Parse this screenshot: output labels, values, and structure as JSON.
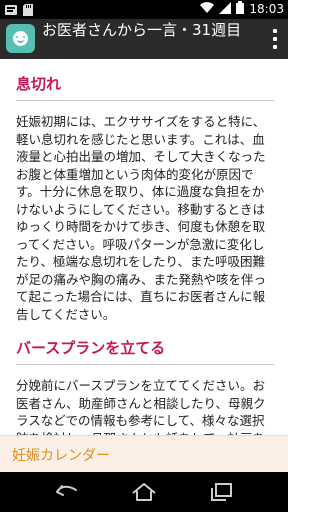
{
  "status_bar": {
    "time": "18:03",
    "icons": [
      "notification-icon",
      "sd-card-icon",
      "wifi-icon",
      "signal-icon",
      "battery-icon"
    ]
  },
  "action_bar": {
    "title": "お医者さんから一言・31週目",
    "app_icon": "smiley-face-icon",
    "overflow_icon": "overflow-menu-icon"
  },
  "content": {
    "sections": [
      {
        "title": "息切れ",
        "body": "妊娠初期には、エクササイズをすると特に、軽い息切れを感じたと思います。これは、血液量と心拍出量の増加、そして大きくなったお腹と体重増加という肉体的変化が原因です。十分に休息を取り、体に過度な負担をかけないようにしてください。移動するときはゆっくり時間をかけて歩き、何度も休憩を取ってください。呼吸パターンが急激に変化したり、極端な息切れをしたり、また呼吸困難が足の痛みや胸の痛み、また発熱や咳を伴って起こった場合には、直ちにお医者さんに報告してください。"
      },
      {
        "title": "バースプランを立てる",
        "body": "分娩前にバースプランを立ててください。お医者さん、助産師さんと相談したり、母親クラスなどでの情報も参考にして、様々な選択肢を検討し、旦那さんとも話をして、計画を立ててください。あなたは病院で分娩するのか、ほかの場所で分娩するのかはすでに決め"
      }
    ]
  },
  "bottom_tab": {
    "label": "妊娠カレンダー"
  },
  "nav_bar": {
    "icons": [
      "back-icon",
      "home-icon",
      "recent-apps-icon"
    ]
  },
  "colors": {
    "accent": "#c2185b",
    "tab_text": "#e58d1e",
    "tab_bg": "#fcefe6",
    "app_icon": "#56bfb3"
  }
}
